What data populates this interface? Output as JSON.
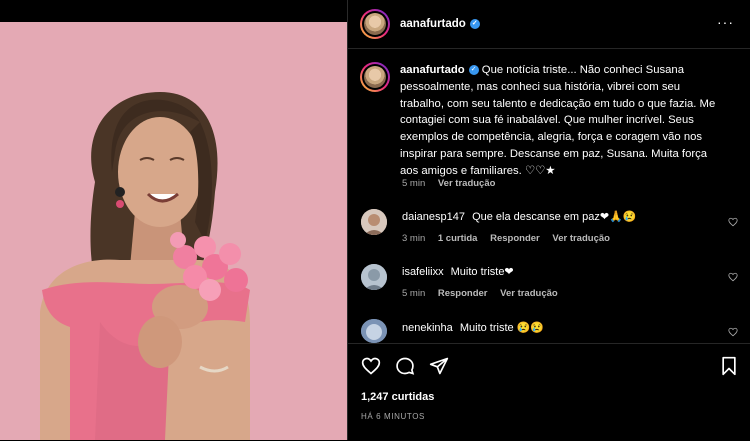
{
  "post": {
    "author": "aanafurtado",
    "caption": "Que notícia triste... Não conheci Susana pessoalmente, mas conheci sua história, vibrei com seu trabalho, com seu talento e dedicação em tudo o que fazia. Me contagiei com sua fé inabalável. Que mulher incrível. Seus exemplos de competência, alegria, força e coragem vão nos inspirar para sempre. Descanse em paz, Susana. Muita força aos amigos e familiares. ♡♡★",
    "caption_time": "5 min",
    "translate_label": "Ver tradução",
    "likes_label": "1,247 curtidas",
    "posted_ago": "HÁ 6 MINUTOS"
  },
  "comments": [
    {
      "user": "daianesp147",
      "text": "Que ela descanse em paz❤🙏😢",
      "time": "3 min",
      "likes": "1 curtida",
      "reply": "Responder",
      "translate": "Ver tradução"
    },
    {
      "user": "isafeliixx",
      "text": "Muito triste❤",
      "time": "5 min",
      "reply": "Responder",
      "translate": "Ver tradução"
    },
    {
      "user": "nenekinha",
      "text": "Muito triste 😢😢"
    }
  ],
  "icons": {
    "like": "heart-icon",
    "comment": "comment-icon",
    "share": "share-icon",
    "save": "bookmark-icon",
    "more": "more-icon"
  },
  "colors": {
    "background": "#000000",
    "photo_bg": "#e4a9b4",
    "dress": "#e8718b",
    "verified": "#3897f0",
    "meta_text": "#a8a8a8"
  }
}
